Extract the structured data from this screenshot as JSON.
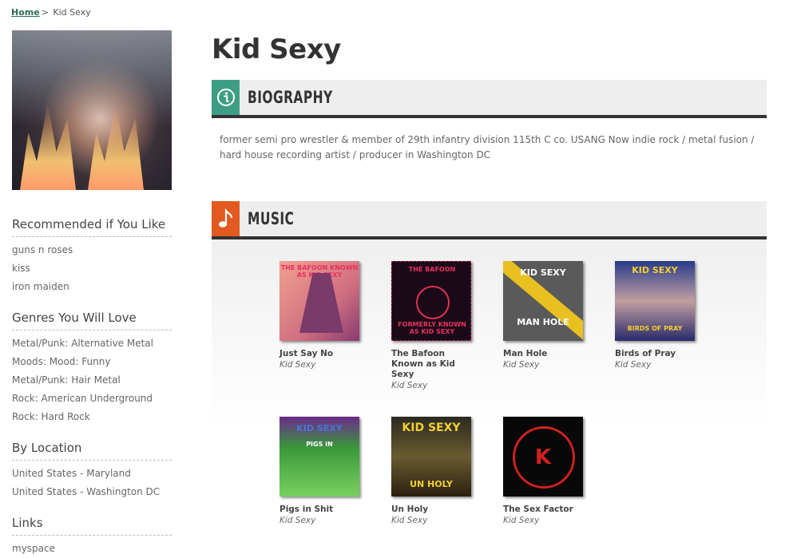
{
  "breadcrumb": {
    "home": "Home",
    "separator": ">",
    "current": "Kid Sexy"
  },
  "artist": {
    "name": "Kid Sexy",
    "photo": "artist-photo"
  },
  "sidebar": {
    "recommended": {
      "title": "Recommended if You Like",
      "items": [
        "guns n roses",
        "kiss",
        "iron maiden"
      ]
    },
    "genres": {
      "title": "Genres You Will Love",
      "items": [
        "Metal/Punk: Alternative Metal",
        "Moods: Mood: Funny",
        "Metal/Punk: Hair Metal",
        "Rock: American Underground",
        "Rock: Hard Rock"
      ]
    },
    "location": {
      "title": "By Location",
      "items": [
        "United States - Maryland",
        "United States - Washington DC"
      ]
    },
    "links": {
      "title": "Links",
      "items": [
        "myspace"
      ]
    }
  },
  "biography": {
    "header": "BIOGRAPHY",
    "icon": "info-icon",
    "color": "#3e9e84",
    "text": "former semi pro wrestler & member of 29th infantry division 115th C co. USANG Now indie rock / metal fusion / hard house recording artist / producer in Washington DC"
  },
  "music": {
    "header": "MUSIC",
    "icon": "music-note-icon",
    "color": "#e25a20",
    "albums": [
      {
        "title": "Just Say No",
        "artist": "Kid Sexy",
        "cover_text": "THE BAFOON KNOWN AS KID SEXY"
      },
      {
        "title": "The Bafoon Known as Kid Sexy",
        "artist": "Kid Sexy",
        "cover_text": "THE BAFOON",
        "cover_text2": "FORMERLY KNOWN AS KID SEXY"
      },
      {
        "title": "Man Hole",
        "artist": "Kid Sexy",
        "cover_text": "KID SEXY",
        "cover_text2": "MAN HOLE"
      },
      {
        "title": "Birds of Pray",
        "artist": "Kid Sexy",
        "cover_text": "KID SEXY",
        "cover_text2": "BIRDS OF PRAY"
      },
      {
        "title": "Pigs in Shit",
        "artist": "Kid Sexy",
        "cover_text": "KID SEXY",
        "cover_text2": "PIGS IN"
      },
      {
        "title": "Un Holy",
        "artist": "Kid Sexy",
        "cover_text": "KID SEXY",
        "cover_text2": "UN HOLY"
      },
      {
        "title": "The Sex Factor",
        "artist": "Kid Sexy",
        "cover_text": "K"
      }
    ]
  }
}
